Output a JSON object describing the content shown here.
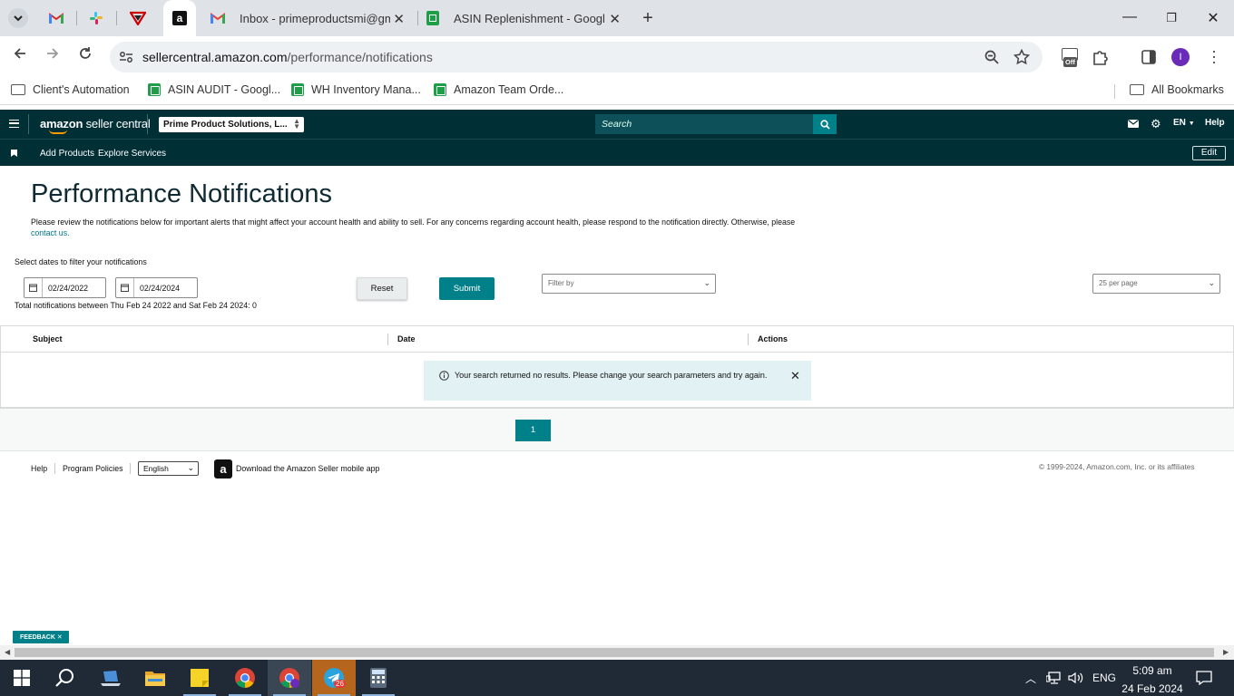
{
  "browser": {
    "tabs": [
      {
        "title": "",
        "icon": "gmail-icon"
      },
      {
        "title": "",
        "icon": "slack-icon"
      },
      {
        "title": "",
        "icon": "vpn-icon"
      },
      {
        "title": "",
        "icon": "amazon-icon",
        "active": true
      },
      {
        "title": "Inbox - primeproductsmi@gma",
        "icon": "gmail-icon"
      },
      {
        "title": "ASIN Replenishment - Google S",
        "icon": "sheets-icon"
      }
    ],
    "url_host": "sellercentral.amazon.com",
    "url_path": "/performance/notifications",
    "extension_badge": "Off",
    "profile_initial": "I",
    "bookmarks": [
      {
        "label": "Client's Automation",
        "icon": "folder-icon"
      },
      {
        "label": "ASIN AUDIT - Googl...",
        "icon": "sheets-icon"
      },
      {
        "label": "WH Inventory Mana...",
        "icon": "sheets-icon"
      },
      {
        "label": "Amazon Team Orde...",
        "icon": "sheets-icon"
      }
    ],
    "all_bookmarks": "All Bookmarks"
  },
  "seller": {
    "logo_bold": "amazon",
    "logo_thin": " seller central",
    "account": "Prime Product Solutions, L...",
    "search_placeholder": "Search",
    "lang": "EN",
    "help": "Help",
    "sub_links": [
      "Add Products",
      "Explore Services"
    ],
    "edit": "Edit"
  },
  "page": {
    "title": "Performance Notifications",
    "intro": "Please review the notifications below for important alerts that might affect your account health and ability to sell. For any concerns regarding account health, please respond to the notification directly. Otherwise, please",
    "contact_link": "contact us.",
    "filter_label": "Select dates to filter your notifications",
    "date_from": "02/24/2022",
    "date_to": "02/24/2024",
    "reset": "Reset",
    "submit": "Submit",
    "filter_by": "Filter by",
    "per_page": "25 per page",
    "total": "Total notifications between Thu Feb 24 2022 and Sat Feb 24 2024: 0",
    "columns": [
      "Subject",
      "Date",
      "Actions"
    ],
    "no_results": "Your search returned no results. Please change your search parameters and try again.",
    "current_page": "1"
  },
  "footer": {
    "help": "Help",
    "policies": "Program Policies",
    "language": "English",
    "app_text": "Download the Amazon Seller mobile app",
    "copyright": "© 1999-2024, Amazon.com, Inc. or its affiliates",
    "feedback": "FEEDBACK"
  },
  "taskbar": {
    "lang": "ENG",
    "time": "5:09 am",
    "date": "24 Feb 2024",
    "telegram_badge": "26",
    "apps": [
      "windows-start-icon",
      "search-icon",
      "laptop-icon",
      "file-explorer-icon",
      "sticky-notes-icon",
      "chrome-icon",
      "chrome-profile-icon",
      "telegram-icon",
      "calculator-icon"
    ]
  },
  "colors": {
    "teal": "#00818a",
    "header": "#002f36",
    "title": "#0f2a33"
  }
}
